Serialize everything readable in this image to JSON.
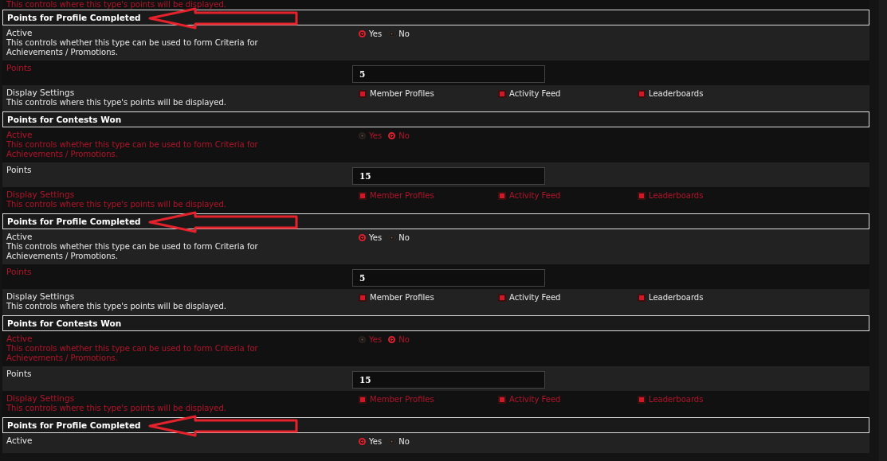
{
  "top_fragment": {
    "text": "This controls where this type's points will be displayed.",
    "highlighted": true
  },
  "sections": [
    {
      "title": "Points for Profile Completed",
      "annotated": true,
      "rows": [
        {
          "kind": "radio",
          "label": "Active",
          "description": "This controls whether this type can be used to form Criteria for Achievements / Promotions.",
          "highlighted": false,
          "options": [
            {
              "label": "Yes",
              "selected": true
            },
            {
              "label": "No",
              "selected": false
            }
          ]
        },
        {
          "kind": "number",
          "label": "Points",
          "value": "5",
          "highlighted": true
        },
        {
          "kind": "checkboxes",
          "label": "Display Settings",
          "description": "This controls where this type's points will be displayed.",
          "highlighted": false,
          "options": [
            {
              "label": "Member Profiles",
              "checked": true
            },
            {
              "label": "Activity Feed",
              "checked": true
            },
            {
              "label": "Leaderboards",
              "checked": true
            }
          ]
        }
      ]
    },
    {
      "title": "Points for Contests Won",
      "annotated": false,
      "rows": [
        {
          "kind": "radio",
          "label": "Active",
          "description": "This controls whether this type can be used to form Criteria for Achievements / Promotions.",
          "highlighted": true,
          "options": [
            {
              "label": "Yes",
              "selected": false
            },
            {
              "label": "No",
              "selected": true
            }
          ]
        },
        {
          "kind": "number",
          "label": "Points",
          "value": "15",
          "highlighted": false
        },
        {
          "kind": "checkboxes",
          "label": "Display Settings",
          "description": "This controls where this type's points will be displayed.",
          "highlighted": true,
          "options": [
            {
              "label": "Member Profiles",
              "checked": true
            },
            {
              "label": "Activity Feed",
              "checked": true
            },
            {
              "label": "Leaderboards",
              "checked": true
            }
          ]
        }
      ]
    },
    {
      "title": "Points for Profile Completed",
      "annotated": true,
      "rows": [
        {
          "kind": "radio",
          "label": "Active",
          "description": "This controls whether this type can be used to form Criteria for Achievements / Promotions.",
          "highlighted": false,
          "options": [
            {
              "label": "Yes",
              "selected": true
            },
            {
              "label": "No",
              "selected": false
            }
          ]
        },
        {
          "kind": "number",
          "label": "Points",
          "value": "5",
          "highlighted": true
        },
        {
          "kind": "checkboxes",
          "label": "Display Settings",
          "description": "This controls where this type's points will be displayed.",
          "highlighted": false,
          "options": [
            {
              "label": "Member Profiles",
              "checked": true
            },
            {
              "label": "Activity Feed",
              "checked": true
            },
            {
              "label": "Leaderboards",
              "checked": true
            }
          ]
        }
      ]
    },
    {
      "title": "Points for Contests Won",
      "annotated": false,
      "rows": [
        {
          "kind": "radio",
          "label": "Active",
          "description": "This controls whether this type can be used to form Criteria for Achievements / Promotions.",
          "highlighted": true,
          "options": [
            {
              "label": "Yes",
              "selected": false
            },
            {
              "label": "No",
              "selected": true
            }
          ]
        },
        {
          "kind": "number",
          "label": "Points",
          "value": "15",
          "highlighted": false
        },
        {
          "kind": "checkboxes",
          "label": "Display Settings",
          "description": "This controls where this type's points will be displayed.",
          "highlighted": true,
          "options": [
            {
              "label": "Member Profiles",
              "checked": true
            },
            {
              "label": "Activity Feed",
              "checked": true
            },
            {
              "label": "Leaderboards",
              "checked": true
            }
          ]
        }
      ]
    },
    {
      "title": "Points for Profile Completed",
      "annotated": true,
      "rows": [
        {
          "kind": "radio",
          "label": "Active",
          "highlighted": false,
          "options": [
            {
              "label": "Yes",
              "selected": true
            },
            {
              "label": "No",
              "selected": false
            }
          ]
        }
      ]
    }
  ]
}
